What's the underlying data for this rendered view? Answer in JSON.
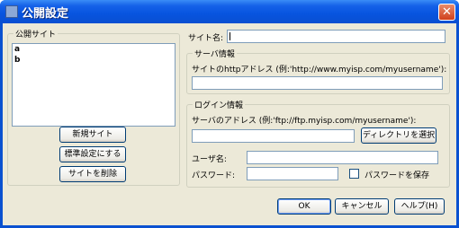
{
  "window": {
    "title": "公開設定",
    "close_glyph": "✕"
  },
  "sites_group": {
    "label": "公開サイト",
    "items": [
      "a",
      "b"
    ]
  },
  "site_buttons": {
    "new_site": "新規サイト",
    "set_default": "標準設定にする",
    "delete_site": "サイトを削除"
  },
  "site_name": {
    "label": "サイト名:",
    "value": ""
  },
  "server_info": {
    "label": "サーバ情報",
    "http_label": "サイトのhttpアドレス (例:'http://www.myisp.com/myusername'):",
    "http_value": ""
  },
  "login_info": {
    "label": "ログイン情報",
    "server_label": "サーバのアドレス (例:'ftp://ftp.myisp.com/myusername'):",
    "server_value": "",
    "browse_button": "ディレクトリを選択",
    "user_label": "ユーザ名:",
    "user_value": "",
    "password_label": "パスワード:",
    "password_value": "",
    "save_password_label": "パスワードを保存",
    "save_password_checked": false
  },
  "footer": {
    "ok": "OK",
    "cancel": "キャンセル",
    "help": "ヘルプ(H)"
  }
}
